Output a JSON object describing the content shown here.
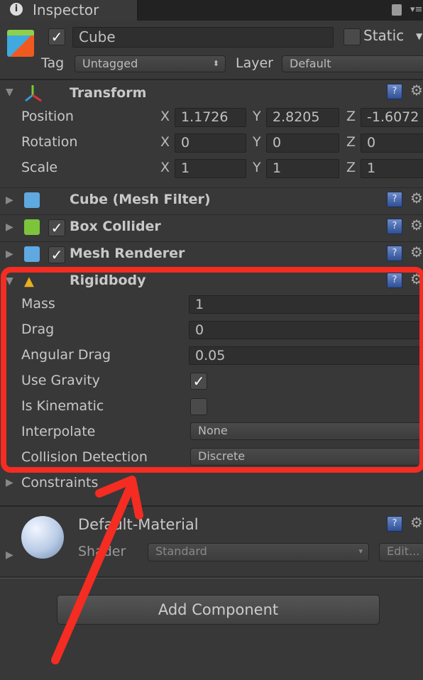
{
  "tab": {
    "title": "Inspector",
    "icon": "info-icon"
  },
  "object": {
    "name": "Cube",
    "active": true,
    "static_label": "Static",
    "static": false,
    "tag_label": "Tag",
    "tag": "Untagged",
    "layer_label": "Layer",
    "layer": "Default"
  },
  "transform": {
    "title": "Transform",
    "rows": [
      {
        "label": "Position",
        "x": "1.1726",
        "y": "2.8205",
        "z": "-1.6072"
      },
      {
        "label": "Rotation",
        "x": "0",
        "y": "0",
        "z": "0"
      },
      {
        "label": "Scale",
        "x": "1",
        "y": "1",
        "z": "1"
      }
    ],
    "axes": [
      "X",
      "Y",
      "Z"
    ]
  },
  "components": [
    {
      "title": "Cube (Mesh Filter)",
      "has_checkbox": false
    },
    {
      "title": "Box Collider",
      "has_checkbox": true,
      "enabled": true
    },
    {
      "title": "Mesh Renderer",
      "has_checkbox": true,
      "enabled": true
    }
  ],
  "rigidbody": {
    "title": "Rigidbody",
    "mass_label": "Mass",
    "mass": "1",
    "drag_label": "Drag",
    "drag": "0",
    "angular_drag_label": "Angular Drag",
    "angular_drag": "0.05",
    "use_gravity_label": "Use Gravity",
    "use_gravity": true,
    "is_kinematic_label": "Is Kinematic",
    "is_kinematic": false,
    "interpolate_label": "Interpolate",
    "interpolate": "None",
    "collision_label": "Collision Detection",
    "collision": "Discrete",
    "constraints_label": "Constraints"
  },
  "material": {
    "name": "Default-Material",
    "shader_label": "Shader",
    "shader": "Standard",
    "edit_label": "Edit..."
  },
  "add_component_label": "Add Component",
  "annotation_color": "#f42c22"
}
